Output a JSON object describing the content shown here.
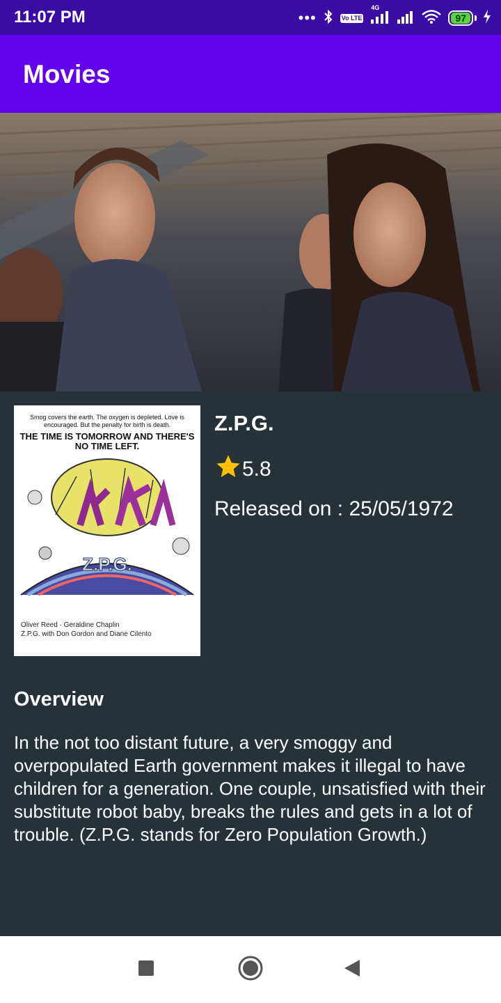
{
  "status_bar": {
    "time": "11:07 PM",
    "battery": "97",
    "volte_label": "Vo LTE",
    "network_label": "4G"
  },
  "app_bar": {
    "title": "Movies"
  },
  "movie": {
    "title": "Z.P.G.",
    "rating": "5.8",
    "release": "Released on : 25/05/1972",
    "poster": {
      "tagline": "Smog covers the earth. The oxygen is depleted. Love is encouraged. But the penalty for birth is death.",
      "headline": "THE TIME IS TOMORROW AND THERE'S NO TIME LEFT.",
      "logo_text": "Z.P.G.",
      "cast": "Oliver Reed · Geraldine Chaplin",
      "cast2": "Z.P.G. with Don Gordon and Diane Cilento"
    }
  },
  "overview": {
    "heading": "Overview",
    "text": "In the not too distant future, a very smoggy and overpopulated Earth government makes it illegal to have children for a generation. One couple, unsatisfied with their substitute robot baby, breaks the rules and gets in a lot of trouble. (Z.P.G. stands for Zero Population Growth.)"
  },
  "colors": {
    "status_bar": "#3a0ca3",
    "app_bar": "#6200ee",
    "background": "#263238",
    "star": "#ffc107"
  },
  "icons": [
    "bluetooth-icon",
    "signal-icon",
    "wifi-icon",
    "battery-icon",
    "star-icon",
    "nav-recents-icon",
    "nav-home-icon",
    "nav-back-icon"
  ]
}
